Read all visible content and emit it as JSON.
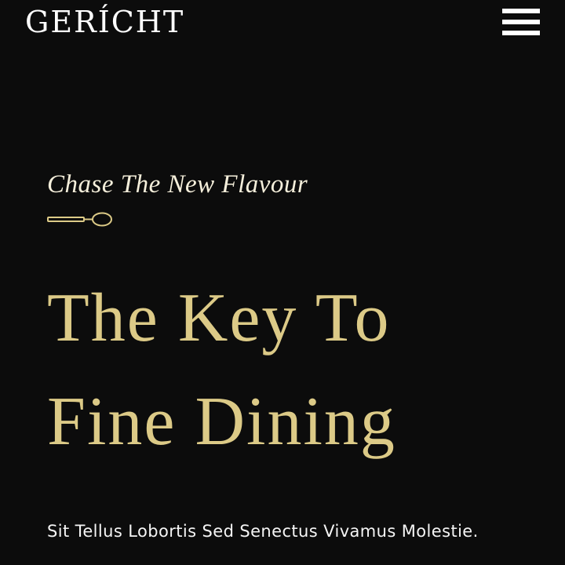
{
  "header": {
    "logo_text": "GERÍCHT",
    "menu_icon": "hamburger-menu-icon"
  },
  "hero": {
    "subtitle": "Chase The New Flavour",
    "divider_icon": "spoon-icon",
    "headline_line1": "The Key To",
    "headline_line2": "Fine Dining",
    "description": "Sit Tellus Lobortis Sed Senectus Vivamus Molestie."
  },
  "colors": {
    "background": "#0c0c0c",
    "accent_gold": "#dcca87",
    "text_white": "#ffffff"
  }
}
